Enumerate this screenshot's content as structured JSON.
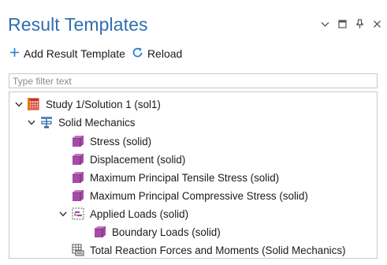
{
  "panel": {
    "title": "Result Templates"
  },
  "window_controls": [
    "chevron-down-icon",
    "maximize-icon",
    "pin-icon",
    "close-icon"
  ],
  "toolbar": {
    "add_label": "Add Result Template",
    "reload_label": "Reload"
  },
  "filter": {
    "placeholder": "Type filter text",
    "value": ""
  },
  "tree": {
    "study": {
      "label": "Study 1/Solution 1 (sol1)",
      "icon": "study-solution-icon",
      "expanded": true
    },
    "physics": {
      "label": "Solid Mechanics",
      "icon": "solid-mechanics-icon",
      "expanded": true
    },
    "items": [
      {
        "label": "Stress (solid)",
        "icon": "plot-group-3d-icon"
      },
      {
        "label": "Displacement (solid)",
        "icon": "plot-group-3d-icon"
      },
      {
        "label": "Maximum Principal Tensile Stress (solid)",
        "icon": "plot-group-3d-icon"
      },
      {
        "label": "Maximum Principal Compressive Stress (solid)",
        "icon": "plot-group-3d-icon"
      }
    ],
    "group": {
      "label": "Applied Loads (solid)",
      "icon": "group-folder-icon",
      "expanded": true,
      "children": [
        {
          "label": "Boundary Loads (solid)",
          "icon": "plot-group-3d-icon"
        }
      ]
    },
    "table_item": {
      "label": "Total Reaction Forces and Moments (Solid Mechanics)",
      "icon": "table-evaluation-icon"
    }
  },
  "colors": {
    "title": "#2e6fb0",
    "accent_blue": "#1f7fd6",
    "plot_purple": "#a64aa8",
    "plot_purple_dark": "#6e2a73",
    "study_red": "#cc2a1e"
  }
}
